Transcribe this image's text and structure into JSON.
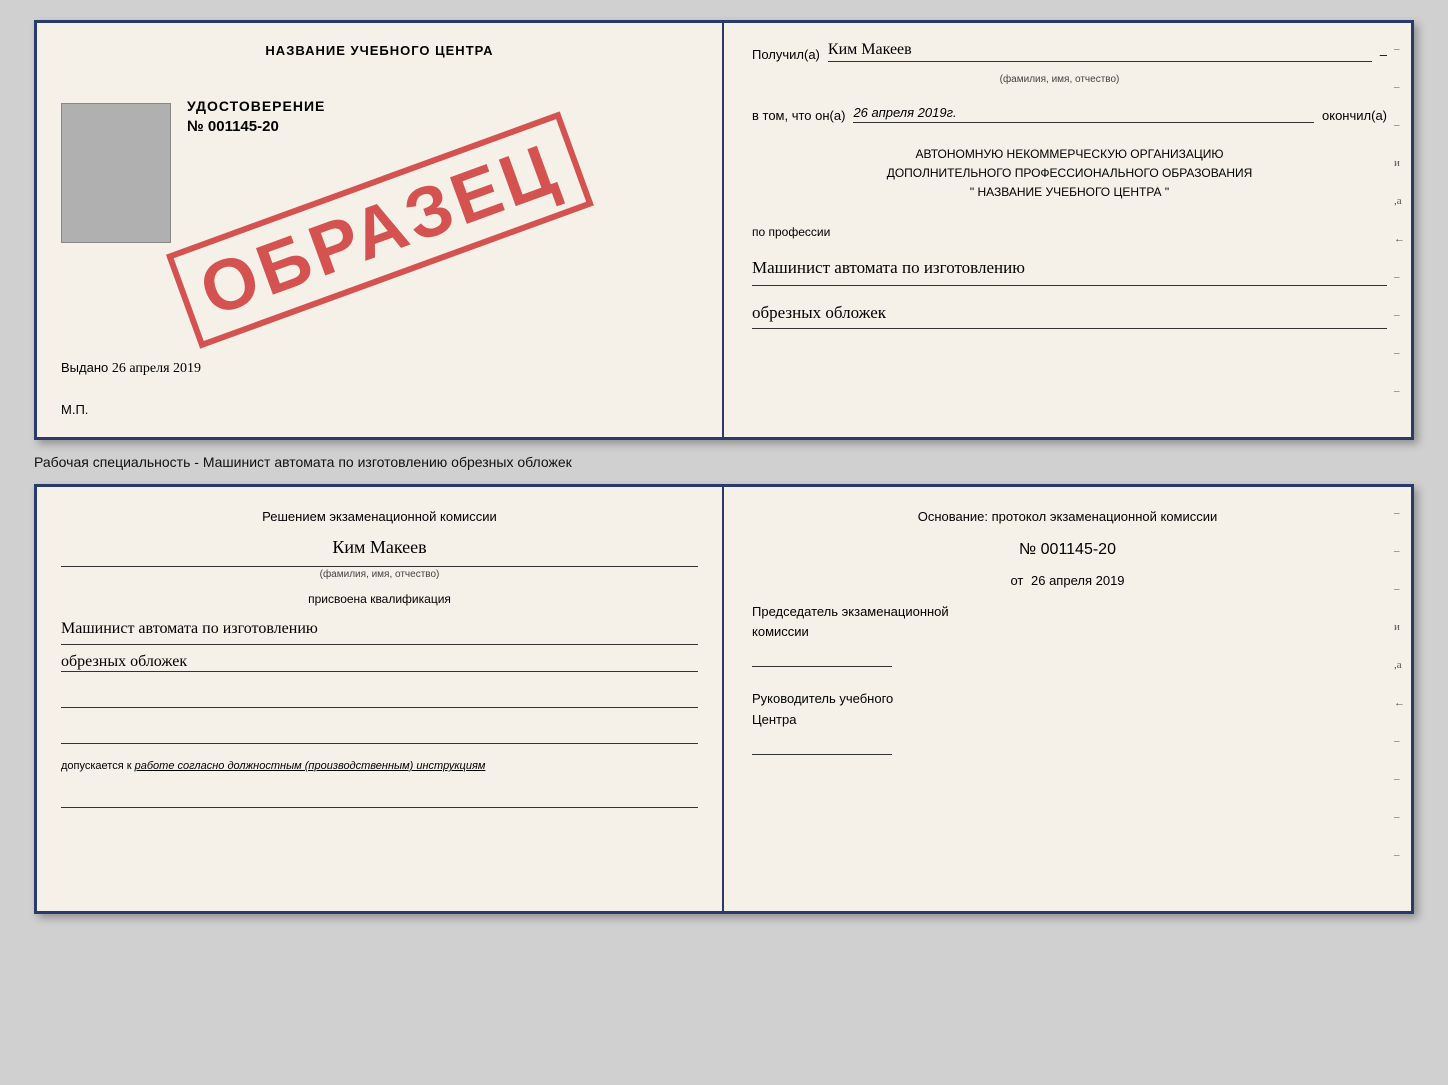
{
  "topCert": {
    "left": {
      "schoolName": "НАЗВАНИЕ УЧЕБНОГО ЦЕНТРА",
      "certTitle": "УДОСТОВЕРЕНИЕ",
      "certNumber": "№ 001145-20",
      "issuedLabel": "Выдано",
      "issuedDate": "26 апреля 2019",
      "mpLabel": "М.П.",
      "stampText": "ОБРАЗЕЦ"
    },
    "right": {
      "receivedLabel": "Получил(а)",
      "recipientName": "Ким Макеев",
      "recipientSubLabel": "(фамилия, имя, отчество)",
      "dashLabel": "–",
      "dateLabel": "в том, что он(а)",
      "dateValue": "26 апреля 2019г.",
      "finishedLabel": "окончил(а)",
      "orgLine1": "АВТОНОМНУЮ НЕКОММЕРЧЕСКУЮ ОРГАНИЗАЦИЮ",
      "orgLine2": "ДОПОЛНИТЕЛЬНОГО ПРОФЕССИОНАЛЬНОГО ОБРАЗОВАНИЯ",
      "orgLine3": "\" НАЗВАНИЕ УЧЕБНОГО ЦЕНТРА \"",
      "professionLabel": "по профессии",
      "professionLine1": "Машинист автомата по изготовлению",
      "professionLine2": "обрезных обложек"
    }
  },
  "middleText": "Рабочая специальность - Машинист автомата по изготовлению обрезных обложек",
  "bottomCert": {
    "left": {
      "commissionTitle1": "Решением экзаменационной комиссии",
      "recipientName": "Ким Макеев",
      "recipientSubLabel": "(фамилия, имя, отчество)",
      "assignedLabel": "присвоена квалификация",
      "qualLine1": "Машинист автомата по изготовлению",
      "qualLine2": "обрезных обложек",
      "allowedLabel": "допускается к",
      "allowedText": "работе согласно должностным (производственным) инструкциям"
    },
    "right": {
      "basisLabel": "Основание: протокол экзаменационной комиссии",
      "protocolNumber": "№ 001145-20",
      "datePrefix": "от",
      "protocolDate": "26 апреля 2019",
      "chairmanLabel1": "Председатель экзаменационной",
      "chairmanLabel2": "комиссии",
      "managerLabel1": "Руководитель учебного",
      "managerLabel2": "Центра"
    }
  },
  "dashes": {
    "marks": [
      "–",
      "–",
      "–",
      "и",
      ",а",
      "←",
      "–",
      "–",
      "–",
      "–"
    ]
  }
}
